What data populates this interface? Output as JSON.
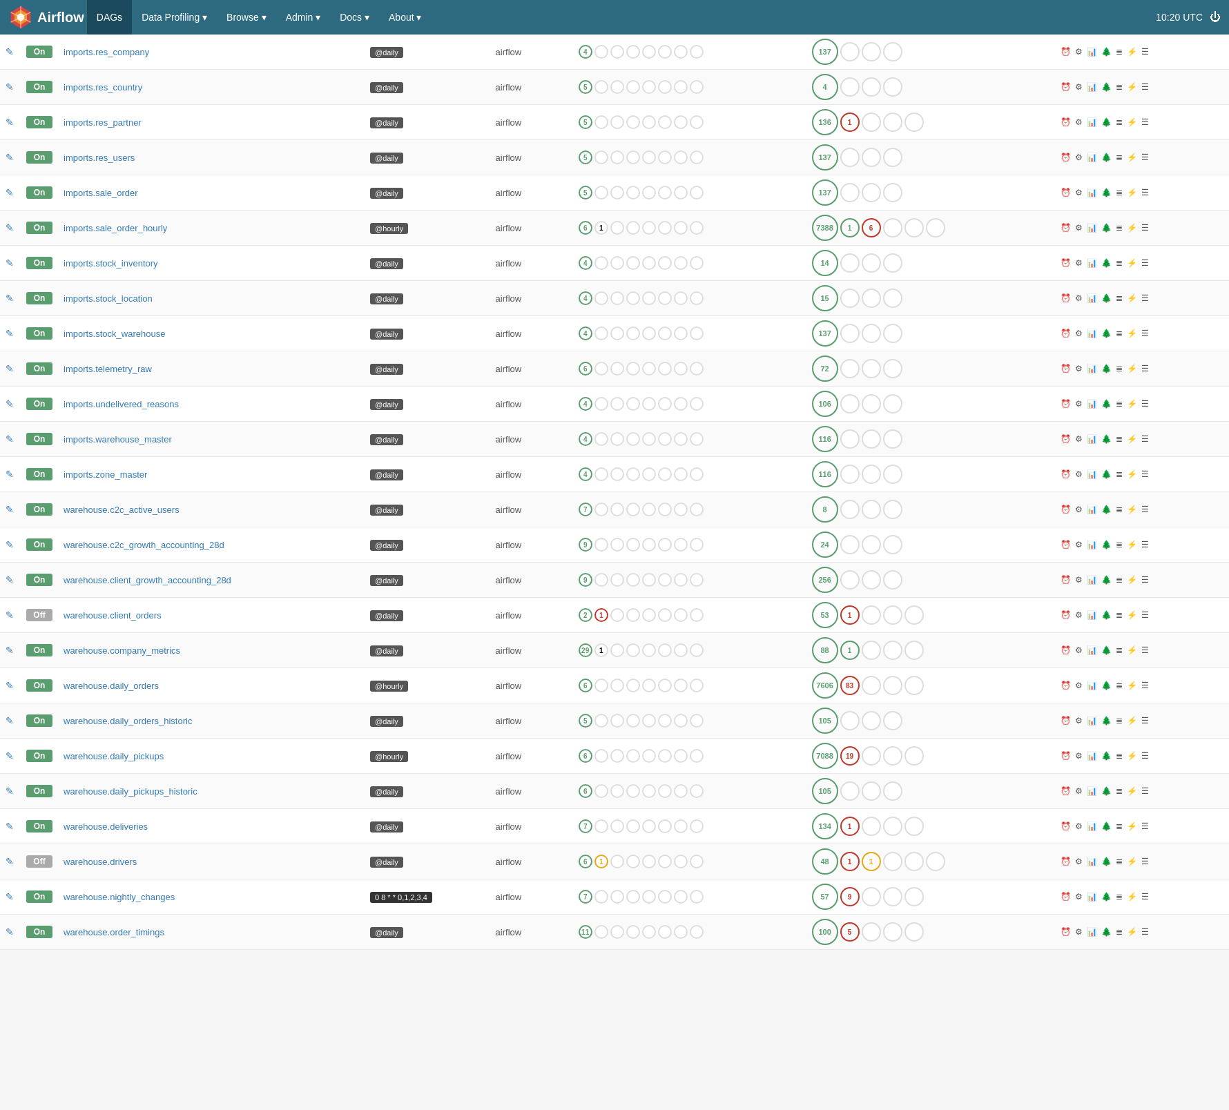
{
  "navbar": {
    "brand": "Airflow",
    "time": "10:20 UTC",
    "items": [
      {
        "label": "DAGs",
        "active": true
      },
      {
        "label": "Data Profiling ▾",
        "active": false
      },
      {
        "label": "Browse ▾",
        "active": false
      },
      {
        "label": "Admin ▾",
        "active": false
      },
      {
        "label": "Docs ▾",
        "active": false
      },
      {
        "label": "About ▾",
        "active": false
      }
    ]
  },
  "dags": [
    {
      "name": "imports.res_company",
      "state": "On",
      "schedule": "@daily",
      "owner": "airflow",
      "recent": [
        {
          "count": 4,
          "type": "green"
        }
      ],
      "runs_total": 137,
      "runs_red": 0,
      "runs_yellow": 0
    },
    {
      "name": "imports.res_country",
      "state": "On",
      "schedule": "@daily",
      "owner": "airflow",
      "recent": [
        {
          "count": 5,
          "type": "green"
        }
      ],
      "runs_total": 4,
      "runs_red": 0,
      "runs_yellow": 0
    },
    {
      "name": "imports.res_partner",
      "state": "On",
      "schedule": "@daily",
      "owner": "airflow",
      "recent": [
        {
          "count": 5,
          "type": "green"
        }
      ],
      "runs_total": 136,
      "runs_red": 1,
      "runs_yellow": 0
    },
    {
      "name": "imports.res_users",
      "state": "On",
      "schedule": "@daily",
      "owner": "airflow",
      "recent": [
        {
          "count": 5,
          "type": "green"
        }
      ],
      "runs_total": 137,
      "runs_red": 0,
      "runs_yellow": 0
    },
    {
      "name": "imports.sale_order",
      "state": "On",
      "schedule": "@daily",
      "owner": "airflow",
      "recent": [
        {
          "count": 5,
          "type": "green"
        }
      ],
      "runs_total": 137,
      "runs_red": 0,
      "runs_yellow": 0
    },
    {
      "name": "imports.sale_order_hourly",
      "state": "On",
      "schedule": "@hourly",
      "owner": "airflow",
      "recent": [
        {
          "count": 6,
          "type": "green"
        },
        {
          "count": 1,
          "type": "green-outline"
        }
      ],
      "runs_total": 7388,
      "runs_red": 6,
      "runs_yellow": 0,
      "runs_extra": 1
    },
    {
      "name": "imports.stock_inventory",
      "state": "On",
      "schedule": "@daily",
      "owner": "airflow",
      "recent": [
        {
          "count": 4,
          "type": "green"
        }
      ],
      "runs_total": 14,
      "runs_red": 0,
      "runs_yellow": 0
    },
    {
      "name": "imports.stock_location",
      "state": "On",
      "schedule": "@daily",
      "owner": "airflow",
      "recent": [
        {
          "count": 4,
          "type": "green"
        }
      ],
      "runs_total": 15,
      "runs_red": 0,
      "runs_yellow": 0
    },
    {
      "name": "imports.stock_warehouse",
      "state": "On",
      "schedule": "@daily",
      "owner": "airflow",
      "recent": [
        {
          "count": 4,
          "type": "green"
        }
      ],
      "runs_total": 137,
      "runs_red": 0,
      "runs_yellow": 0
    },
    {
      "name": "imports.telemetry_raw",
      "state": "On",
      "schedule": "@daily",
      "owner": "airflow",
      "recent": [
        {
          "count": 6,
          "type": "green"
        }
      ],
      "runs_total": 72,
      "runs_red": 0,
      "runs_yellow": 0
    },
    {
      "name": "imports.undelivered_reasons",
      "state": "On",
      "schedule": "@daily",
      "owner": "airflow",
      "recent": [
        {
          "count": 4,
          "type": "green"
        }
      ],
      "runs_total": 106,
      "runs_red": 0,
      "runs_yellow": 0
    },
    {
      "name": "imports.warehouse_master",
      "state": "On",
      "schedule": "@daily",
      "owner": "airflow",
      "recent": [
        {
          "count": 4,
          "type": "green"
        }
      ],
      "runs_total": 116,
      "runs_red": 0,
      "runs_yellow": 0
    },
    {
      "name": "imports.zone_master",
      "state": "On",
      "schedule": "@daily",
      "owner": "airflow",
      "recent": [
        {
          "count": 4,
          "type": "green"
        }
      ],
      "runs_total": 116,
      "runs_red": 0,
      "runs_yellow": 0
    },
    {
      "name": "warehouse.c2c_active_users",
      "state": "On",
      "schedule": "@daily",
      "owner": "airflow",
      "recent": [
        {
          "count": 7,
          "type": "green"
        }
      ],
      "runs_total": 8,
      "runs_red": 0,
      "runs_yellow": 0
    },
    {
      "name": "warehouse.c2c_growth_accounting_28d",
      "state": "On",
      "schedule": "@daily",
      "owner": "airflow",
      "recent": [
        {
          "count": 9,
          "type": "green"
        }
      ],
      "runs_total": 24,
      "runs_red": 0,
      "runs_yellow": 0
    },
    {
      "name": "warehouse.client_growth_accounting_28d",
      "state": "On",
      "schedule": "@daily",
      "owner": "airflow",
      "recent": [
        {
          "count": 9,
          "type": "green"
        }
      ],
      "runs_total": 256,
      "runs_red": 0,
      "runs_yellow": 0
    },
    {
      "name": "warehouse.client_orders",
      "state": "Off",
      "schedule": "@daily",
      "owner": "airflow",
      "recent": [
        {
          "count": 2,
          "type": "green"
        },
        {
          "count": 1,
          "type": "red"
        }
      ],
      "runs_total": 53,
      "runs_red": 1,
      "runs_yellow": 0
    },
    {
      "name": "warehouse.company_metrics",
      "state": "On",
      "schedule": "@daily",
      "owner": "airflow",
      "recent": [
        {
          "count": 29,
          "type": "green"
        },
        {
          "count": 1,
          "type": "green-outline"
        }
      ],
      "runs_total": 88,
      "runs_red": 0,
      "runs_yellow": 0,
      "runs_extra": 1
    },
    {
      "name": "warehouse.daily_orders",
      "state": "On",
      "schedule": "@hourly",
      "owner": "airflow",
      "recent": [
        {
          "count": 6,
          "type": "green"
        }
      ],
      "runs_total": 7606,
      "runs_red": 83,
      "runs_yellow": 0
    },
    {
      "name": "warehouse.daily_orders_historic",
      "state": "On",
      "schedule": "@daily",
      "owner": "airflow",
      "recent": [
        {
          "count": 5,
          "type": "green"
        }
      ],
      "runs_total": 105,
      "runs_red": 0,
      "runs_yellow": 0
    },
    {
      "name": "warehouse.daily_pickups",
      "state": "On",
      "schedule": "@hourly",
      "owner": "airflow",
      "recent": [
        {
          "count": 6,
          "type": "green"
        }
      ],
      "runs_total": 7088,
      "runs_red": 19,
      "runs_yellow": 0
    },
    {
      "name": "warehouse.daily_pickups_historic",
      "state": "On",
      "schedule": "@daily",
      "owner": "airflow",
      "recent": [
        {
          "count": 6,
          "type": "green"
        }
      ],
      "runs_total": 105,
      "runs_red": 0,
      "runs_yellow": 0
    },
    {
      "name": "warehouse.deliveries",
      "state": "On",
      "schedule": "@daily",
      "owner": "airflow",
      "recent": [
        {
          "count": 7,
          "type": "green"
        }
      ],
      "runs_total": 134,
      "runs_red": 1,
      "runs_yellow": 0
    },
    {
      "name": "warehouse.drivers",
      "state": "Off",
      "schedule": "@daily",
      "owner": "airflow",
      "recent": [
        {
          "count": 6,
          "type": "green"
        },
        {
          "count": 1,
          "type": "yellow"
        }
      ],
      "runs_total": 48,
      "runs_red": 1,
      "runs_yellow": 1
    },
    {
      "name": "warehouse.nightly_changes",
      "state": "On",
      "schedule": "0 8 * * 0,1,2,3,4",
      "owner": "airflow",
      "recent": [
        {
          "count": 7,
          "type": "green"
        }
      ],
      "runs_total": 57,
      "runs_red": 9,
      "runs_yellow": 0
    },
    {
      "name": "warehouse.order_timings",
      "state": "On",
      "schedule": "@daily",
      "owner": "airflow",
      "recent": [
        {
          "count": 11,
          "type": "green"
        }
      ],
      "runs_total": 100,
      "runs_red": 5,
      "runs_yellow": 0
    }
  ]
}
